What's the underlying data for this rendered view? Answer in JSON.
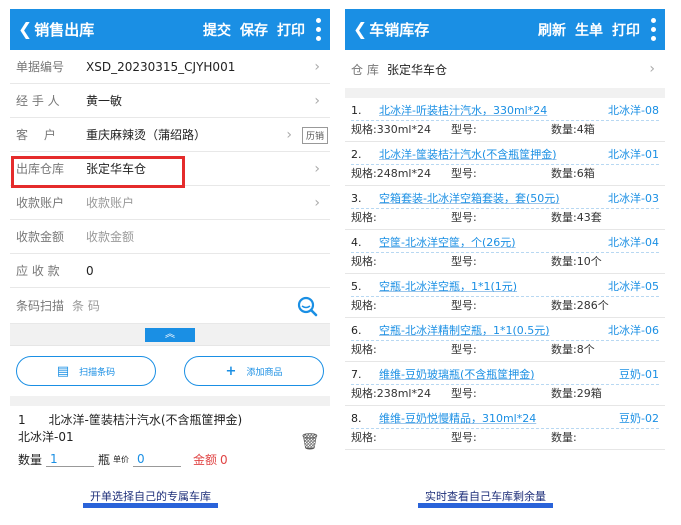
{
  "left": {
    "title": "销售出库",
    "actions": [
      "提交",
      "保存",
      "打印"
    ],
    "fields": [
      {
        "label": "单据编号",
        "value": "XSD_20230315_CJYH001",
        "placeholder": false
      },
      {
        "label": "经 手 人",
        "value": "黄一敏",
        "placeholder": false
      },
      {
        "label": "客　 户",
        "value": "重庆麻辣烫（蒲绍路）",
        "placeholder": false
      },
      {
        "label": "出库仓库",
        "value": "张定华车仓",
        "placeholder": false
      },
      {
        "label": "收款账户",
        "value": "收款账户",
        "placeholder": true
      },
      {
        "label": "收款金额",
        "value": "收款金额",
        "placeholder": true
      },
      {
        "label": "应 收 款",
        "value": "0",
        "placeholder": false
      },
      {
        "label": "条码扫描",
        "value": "条 码",
        "placeholder": true
      }
    ],
    "customer_badge": "历销",
    "expander": "︽",
    "scan_button": "扫描条码",
    "add_button": "添加商品",
    "item": {
      "index": "1",
      "name": "北冰洋-筐装桔汁汽水(不含瓶筐押金)",
      "code": "北冰洋-01",
      "qty_label": "数量",
      "qty_value": "1",
      "unit": "瓶",
      "price_label": "单价",
      "price_value": "0",
      "amount_label": "金额",
      "amount_value": "0"
    },
    "caption": "开单选择自己的专属车库"
  },
  "right": {
    "title": "车销库存",
    "actions": [
      "刷新",
      "生单",
      "打印"
    ],
    "warehouse_label": "仓 库",
    "warehouse_value": "张定华车仓",
    "spec_label": "规格:",
    "type_label": "型号:",
    "qty_label": "数量:",
    "items": [
      {
        "num": "1.",
        "name": "北冰洋-听装桔汁汽水，330ml*24",
        "code": "北冰洋-08",
        "spec": "330ml*24",
        "qty": "4箱"
      },
      {
        "num": "2.",
        "name": "北冰洋-筐装桔汁汽水(不含瓶筐押金)",
        "code": "北冰洋-01",
        "spec": "248ml*24",
        "qty": "6箱"
      },
      {
        "num": "3.",
        "name": "空箱套装-北冰洋空箱套装，套(50元)",
        "code": "北冰洋-03",
        "spec": "",
        "qty": "43套"
      },
      {
        "num": "4.",
        "name": "空筐-北冰洋空筐，个(26元)",
        "code": "北冰洋-04",
        "spec": "",
        "qty": "10个"
      },
      {
        "num": "5.",
        "name": "空瓶-北冰洋空瓶，1*1(1元)",
        "code": "北冰洋-05",
        "spec": "",
        "qty": "286个"
      },
      {
        "num": "6.",
        "name": "空瓶-北冰洋精制空瓶，1*1(0.5元)",
        "code": "北冰洋-06",
        "spec": "",
        "qty": "8个"
      },
      {
        "num": "7.",
        "name": "维维-豆奶玻璃瓶(不含瓶筐押金)",
        "code": "豆奶-01",
        "spec": "238ml*24",
        "qty": "29箱"
      },
      {
        "num": "8.",
        "name": "维维-豆奶悦慢精品，310ml*24",
        "code": "豆奶-02",
        "spec": "",
        "qty": ""
      }
    ],
    "caption": "实时查看自己车库剩余量"
  }
}
